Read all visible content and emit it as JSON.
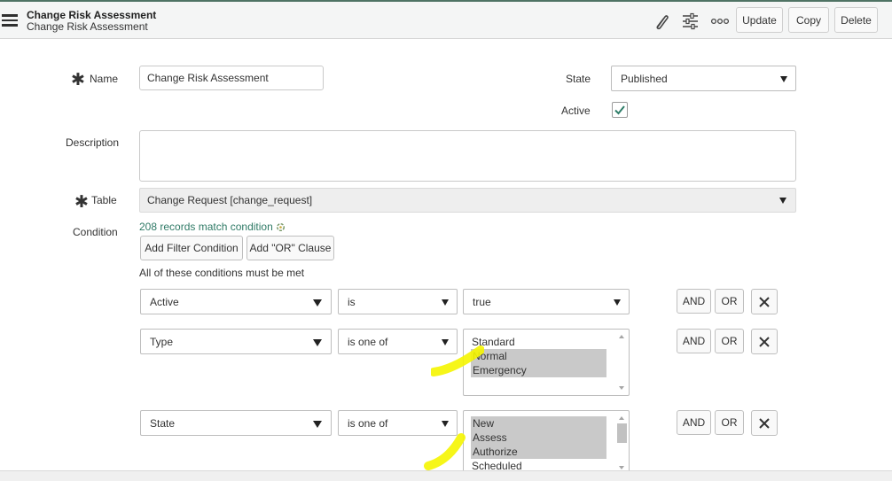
{
  "header": {
    "title": "Change Risk Assessment",
    "subtitle": "Change Risk Assessment",
    "icons": [
      "paperclip-icon",
      "settings-sliders-icon",
      "more-options-icon"
    ],
    "buttons": {
      "update": "Update",
      "copy": "Copy",
      "delete": "Delete"
    }
  },
  "form": {
    "name_label": "Name",
    "name_value": "Change Risk Assessment",
    "state_label": "State",
    "state_value": "Published",
    "active_label": "Active",
    "active_checked": true,
    "description_label": "Description",
    "description_value": "",
    "table_label": "Table",
    "table_value": "Change Request [change_request]",
    "condition_label": "Condition",
    "records_match": "208 records match condition",
    "add_filter_label": "Add Filter Condition",
    "add_or_label": "Add \"OR\" Clause",
    "conditions_heading": "All of these conditions must be met"
  },
  "conditions": [
    {
      "field": "Active",
      "operator": "is",
      "value": "true",
      "and": "AND",
      "or": "OR"
    },
    {
      "field": "Type",
      "operator": "is one of",
      "options": [
        {
          "label": "Standard",
          "selected": false
        },
        {
          "label": "Normal",
          "selected": true
        },
        {
          "label": "Emergency",
          "selected": true
        }
      ],
      "and": "AND",
      "or": "OR"
    },
    {
      "field": "State",
      "operator": "is one of",
      "options": [
        {
          "label": "New",
          "selected": true
        },
        {
          "label": "Assess",
          "selected": true
        },
        {
          "label": "Authorize",
          "selected": true
        },
        {
          "label": "Scheduled",
          "selected": false
        }
      ],
      "and": "AND",
      "or": "OR"
    }
  ],
  "colors": {
    "accent_link": "#2f7a66",
    "highlight_marker": "#f5f500",
    "selected_option": "#c9c9c9",
    "check": "#2e7d68"
  }
}
